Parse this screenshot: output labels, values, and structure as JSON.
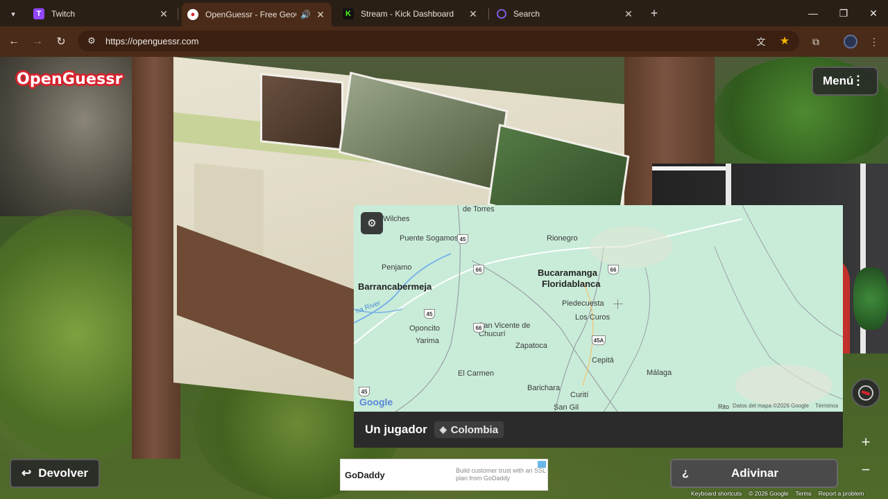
{
  "browser": {
    "tabs": [
      {
        "title": "Twitch",
        "icon": "twitch-icon",
        "color": "#9146ff"
      },
      {
        "title": "OpenGuessr - Free GeoGue",
        "icon": "openguessr-icon",
        "color": "#d6232f",
        "active": true
      },
      {
        "title": "Stream - Kick Dashboard",
        "icon": "kick-icon",
        "color": "#53fc18"
      },
      {
        "title": "Search",
        "icon": "search-tab-icon",
        "color": "#7a5bd9"
      }
    ],
    "url": "https://openguessr.com"
  },
  "game": {
    "logo": "OpenGuessr",
    "menu_label": "Menú",
    "mode_label": "Un jugador",
    "country_label": "Colombia",
    "return_label": "Devolver",
    "guess_prefix": "¿",
    "guess_label": "Adivinar",
    "zoom_in": "+",
    "zoom_out": "−"
  },
  "map": {
    "labels": [
      {
        "text": "Wilches"
      },
      {
        "text": "Puente Sogamoso"
      },
      {
        "text": "Penjamo"
      },
      {
        "text": "Barrancabermeja"
      },
      {
        "text": "Rionegro"
      },
      {
        "text": "Bucaramanga"
      },
      {
        "text": "Floridablanca"
      },
      {
        "text": "Piedecuesta"
      },
      {
        "text": "Los Curos"
      },
      {
        "text": "Oponcito"
      },
      {
        "text": "Yarima"
      },
      {
        "text": "San Vicente de Chucurí"
      },
      {
        "text": "Zapatoca"
      },
      {
        "text": "Cepitá"
      },
      {
        "text": "Málaga"
      },
      {
        "text": "El Carmen"
      },
      {
        "text": "Barichara"
      },
      {
        "text": "Curití"
      },
      {
        "text": "San Gil"
      },
      {
        "text": "de Torres"
      },
      {
        "text": "Rito"
      },
      {
        "text": "na River"
      }
    ],
    "shields": [
      "45",
      "66",
      "66",
      "45",
      "66",
      "45A",
      "45"
    ],
    "google": "Google",
    "attribution": "Datos del mapa ©2026 Google",
    "terms": "Términos"
  },
  "ad": {
    "brand": "GoDaddy",
    "copy": "Build customer trust with an SSL plan from GoDaddy"
  },
  "footer": [
    "Keyboard shortcuts",
    "© 2026 Google",
    "Terms",
    "Report a problem"
  ]
}
